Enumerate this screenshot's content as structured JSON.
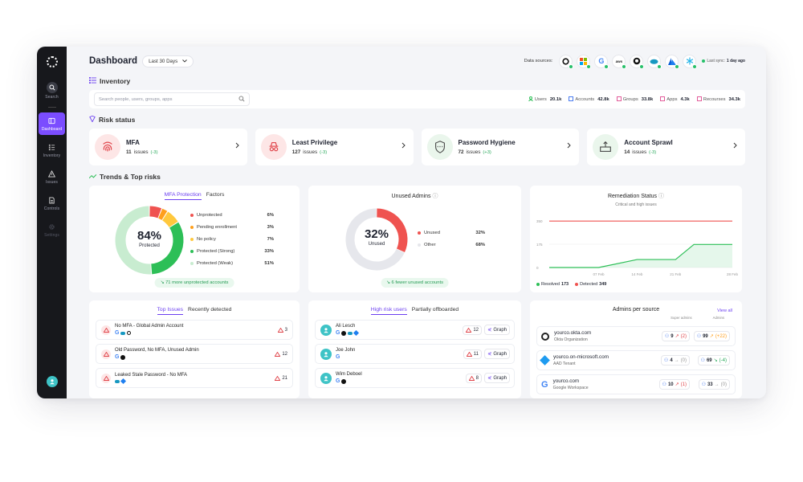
{
  "sidebar": {
    "items": [
      {
        "label": "Search",
        "icon": "search-icon"
      },
      {
        "label": "Dashboard",
        "icon": "dashboard-icon",
        "active": true
      },
      {
        "label": "Inventory",
        "icon": "list-icon"
      },
      {
        "label": "Issues",
        "icon": "warning-icon"
      },
      {
        "label": "Controls",
        "icon": "document-icon"
      },
      {
        "label": "Settings",
        "icon": "gear-icon"
      }
    ]
  },
  "header": {
    "title": "Dashboard",
    "period": "Last 30 Days",
    "data_sources_label": "Data sources:",
    "last_sync_label": "Last sync:",
    "last_sync_value": "1 day ago"
  },
  "inventory": {
    "title": "Inventory",
    "search_placeholder": "Search people, users, groups, apps",
    "counts": [
      {
        "label": "Users",
        "value": "20.1k"
      },
      {
        "label": "Accounts",
        "value": "42.8k"
      },
      {
        "label": "Groups",
        "value": "33.8k"
      },
      {
        "label": "Apps",
        "value": "4.3k"
      },
      {
        "label": "Recourses",
        "value": "34.3k"
      }
    ]
  },
  "risk": {
    "title": "Risk status",
    "cards": [
      {
        "name": "MFA",
        "issues": "11",
        "issues_label": "issues",
        "trend": "(-3)"
      },
      {
        "name": "Least Privilege",
        "issues": "127",
        "issues_label": "issues",
        "trend": "(-3)"
      },
      {
        "name": "Password Hygiene",
        "issues": "72",
        "issues_label": "issues",
        "trend": "(+3)"
      },
      {
        "name": "Account Sprawl",
        "issues": "14",
        "issues_label": "issues",
        "trend": "(-3)"
      }
    ]
  },
  "trends": {
    "title": "Trends & Top risks",
    "mfa": {
      "tabs": [
        "MFA Protection",
        "Factors"
      ],
      "center_value": "84%",
      "center_label": "Protected",
      "legend": [
        {
          "label": "Unprotected",
          "value": "6%",
          "color": "#ef5350"
        },
        {
          "label": "Pending enrollment",
          "value": "3%",
          "color": "#ff9f1c"
        },
        {
          "label": "No policy",
          "value": "7%",
          "color": "#ffc83d"
        },
        {
          "label": "Protected (Strong)",
          "value": "33%",
          "color": "#2dbf57"
        },
        {
          "label": "Protected (Weak)",
          "value": "51%",
          "color": "#c8ecd0"
        }
      ],
      "footer": "71 more unprotected accounts"
    },
    "admins": {
      "title": "Unused Admins",
      "center_value": "32%",
      "center_label": "Unused",
      "legend": [
        {
          "label": "Unused",
          "value": "32%",
          "color": "#ef5350"
        },
        {
          "label": "Other",
          "value": "68%",
          "color": "#e6e7ec"
        }
      ],
      "footer": "6 fewer unused accounts"
    },
    "remediation": {
      "title": "Remediation Status",
      "subtitle": "Critical and high issues",
      "y_ticks": [
        "350",
        "175",
        "0"
      ],
      "x_ticks": [
        "07 Feb",
        "14 Feb",
        "21 Feb",
        "28 Feb"
      ],
      "resolved_label": "Resolved",
      "resolved_value": "173",
      "detected_label": "Detected",
      "detected_value": "349"
    }
  },
  "chart_data": [
    {
      "type": "pie",
      "title": "MFA Protection",
      "categories": [
        "Unprotected",
        "Pending enrollment",
        "No policy",
        "Protected (Strong)",
        "Protected (Weak)"
      ],
      "values": [
        6,
        3,
        7,
        33,
        51
      ]
    },
    {
      "type": "pie",
      "title": "Unused Admins",
      "categories": [
        "Unused",
        "Other"
      ],
      "values": [
        32,
        68
      ]
    },
    {
      "type": "line",
      "title": "Remediation Status",
      "subtitle": "Critical and high issues",
      "x": [
        "01 Feb",
        "07 Feb",
        "14 Feb",
        "21 Feb",
        "24 Feb",
        "28 Feb"
      ],
      "x_ticks": [
        "07 Feb",
        "14 Feb",
        "21 Feb",
        "28 Feb"
      ],
      "series": [
        {
          "name": "Resolved",
          "values": [
            0,
            0,
            60,
            60,
            173,
            173
          ],
          "color": "#2dbf57"
        },
        {
          "name": "Detected",
          "values": [
            349,
            349,
            349,
            349,
            349,
            349
          ],
          "color": "#ef5350"
        }
      ],
      "ylim": [
        0,
        350
      ],
      "legend": "bottom-left"
    }
  ],
  "top_issues": {
    "tabs": [
      "Top Issues",
      "Recently detected"
    ],
    "items": [
      {
        "title": "No MFA - Global Admin Account",
        "count": "3"
      },
      {
        "title": "Old Password, No MFA, Unused Admin",
        "count": "12"
      },
      {
        "title": "Leaked Stale Password - No MFA",
        "count": "21"
      }
    ]
  },
  "high_risk": {
    "tabs": [
      "High risk users",
      "Partially offboarded"
    ],
    "items": [
      {
        "name": "Ali Lesch",
        "count": "12",
        "action": "Graph"
      },
      {
        "name": "Joe John",
        "count": "11",
        "action": "Graph"
      },
      {
        "name": "Wim Deboel",
        "count": "8",
        "action": "Graph"
      }
    ]
  },
  "admins_source": {
    "title": "Admins per source",
    "view_all": "View all",
    "col_super": "Super admins",
    "col_admins": "Admins",
    "rows": [
      {
        "domain": "yourco.okta.com",
        "org": "Okta Organization",
        "super": "9",
        "super_delta": "(2)",
        "admins": "99",
        "admins_delta": "(+22)"
      },
      {
        "domain": "yourco.on-microsoft.com",
        "org": "AAD Tenant",
        "super": "4",
        "super_delta": "(0)",
        "admins": "69",
        "admins_delta": "(-4)"
      },
      {
        "domain": "yourco.com",
        "org": "Google Workspace",
        "super": "10",
        "super_delta": "(1)",
        "admins": "33",
        "admins_delta": "(0)"
      }
    ]
  }
}
